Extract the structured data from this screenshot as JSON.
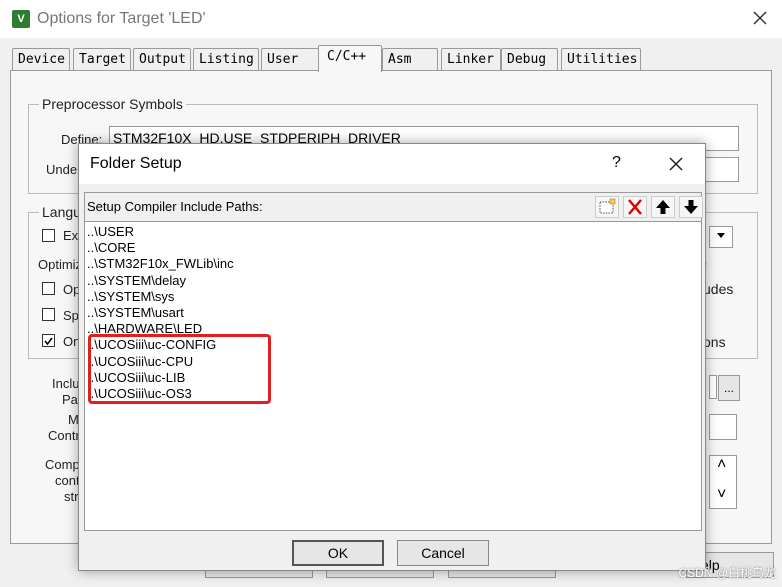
{
  "window": {
    "title": "Options for Target 'LED'",
    "app_icon_letter": "V",
    "close_symbol": "✕"
  },
  "tabs": [
    {
      "label": "Device"
    },
    {
      "label": "Target"
    },
    {
      "label": "Output"
    },
    {
      "label": "Listing"
    },
    {
      "label": "User"
    },
    {
      "label": "C/C++"
    },
    {
      "label": "Asm"
    },
    {
      "label": "Linker"
    },
    {
      "label": "Debug"
    },
    {
      "label": "Utilities"
    }
  ],
  "background": {
    "preprocessor_title": "Preprocessor Symbols",
    "define_label": "Define:",
    "define_value": "STM32F10X_HD,USE_STDPERIPH_DRIVER",
    "undefine_label": "Unde",
    "language_title": "Langu",
    "ex_label": "Ex",
    "optimiz_label": "Optimiz",
    "op_label": "Op",
    "sp_label": "Sp",
    "on_label": "On",
    "includes_label": "udes",
    "ons_label": "ons",
    "e_label": "e",
    "inclu_label": "Inclu",
    "pat_label": "Pat",
    "m_label": "M",
    "contr_label": "Contr",
    "comp_label": "Comp",
    "cont_label": "cont",
    "stri_label": "stri",
    "browse_label": "...",
    "help_label": "elp",
    "scroll_up": "˄",
    "scroll_down": "˅"
  },
  "dialog": {
    "title": "Folder Setup",
    "help": "?",
    "close": "✕",
    "paths_label": "Setup Compiler Include Paths:",
    "paths": [
      "..\\USER",
      "..\\CORE",
      "..\\STM32F10x_FWLib\\inc",
      "..\\SYSTEM\\delay",
      "..\\SYSTEM\\sys",
      "..\\SYSTEM\\usart",
      "..\\HARDWARE\\LED",
      "..\\UCOSiii\\uc-CONFIG",
      "..\\UCOSiii\\uc-CPU",
      "..\\UCOSiii\\uc-LIB",
      "..\\UCOSiii\\uc-OS3"
    ],
    "ok_label": "OK",
    "cancel_label": "Cancel",
    "highlight_color": "#e02020"
  },
  "watermark": "CSDN @白桃乌龙"
}
